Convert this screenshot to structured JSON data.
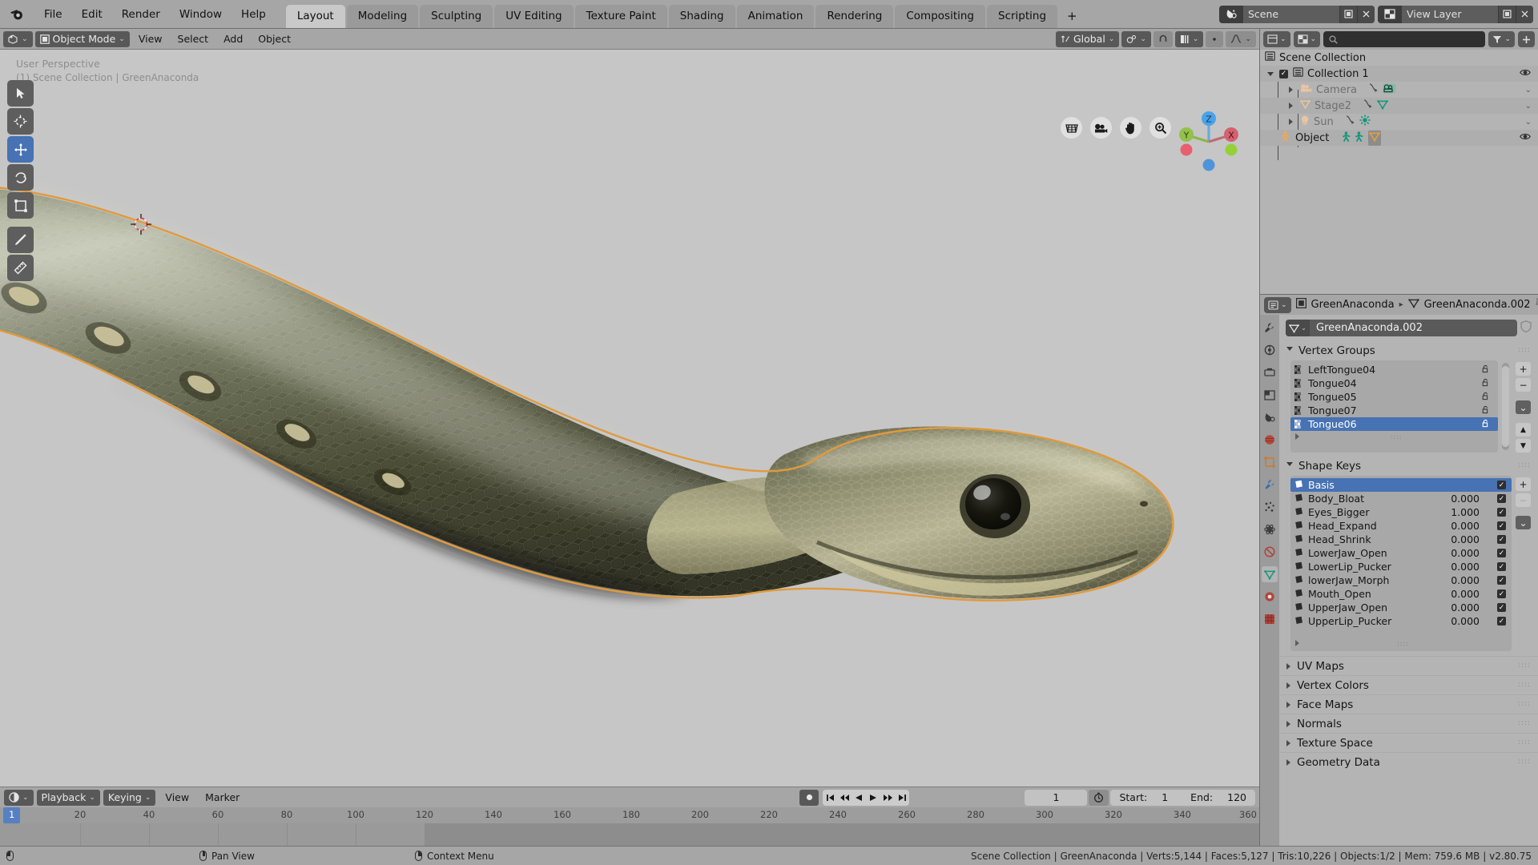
{
  "app": {
    "title": "Blender",
    "version_status": "Scene Collection | GreenAnaconda | Verts:5,144 | Faces:5,127 | Tris:10,226 | Objects:1/2 | Mem: 759.6 MB | v2.80.75"
  },
  "topbar": {
    "menus": [
      "File",
      "Edit",
      "Render",
      "Window",
      "Help"
    ],
    "workspaces": [
      {
        "label": "Layout",
        "active": true
      },
      {
        "label": "Modeling",
        "active": false
      },
      {
        "label": "Sculpting",
        "active": false
      },
      {
        "label": "UV Editing",
        "active": false
      },
      {
        "label": "Texture Paint",
        "active": false
      },
      {
        "label": "Shading",
        "active": false
      },
      {
        "label": "Animation",
        "active": false
      },
      {
        "label": "Rendering",
        "active": false
      },
      {
        "label": "Compositing",
        "active": false
      },
      {
        "label": "Scripting",
        "active": false
      }
    ],
    "add_workspace": "+",
    "scene_name": "Scene",
    "view_layer_name": "View Layer"
  },
  "viewport_header": {
    "mode": "Object Mode",
    "menus": [
      "View",
      "Select",
      "Add",
      "Object"
    ],
    "transform_orientation": "Global",
    "snap_label": "snap-magnet",
    "proportional_label": "proportional-editing"
  },
  "viewport": {
    "perspective_label": "User Perspective",
    "scene_path_label": "(1) Scene Collection | GreenAnaconda",
    "gizmo_axes": {
      "z": "Z",
      "y": "Y",
      "x": "X"
    },
    "tools": [
      "tweak-select-tool",
      "cursor-tool",
      "move-tool",
      "rotate-tool",
      "scale-tool",
      "annotate-tool",
      "measure-tool"
    ],
    "nav_buttons": [
      "grid-view-icon",
      "camera-view-icon",
      "pan-hand-icon",
      "zoom-magnifier-icon"
    ]
  },
  "outliner": {
    "display_mode": "view-layer-icon",
    "filter_icon": "filter-icon",
    "search_placeholder": "",
    "rows": [
      {
        "label": "Scene Collection",
        "indent": 0,
        "icon": "collection-icon",
        "dim": false,
        "checkbox": false,
        "eye": false
      },
      {
        "label": "Collection 1",
        "indent": 1,
        "icon": "collection-icon",
        "dim": false,
        "checkbox": true,
        "eye": true
      },
      {
        "label": "Camera",
        "indent": 2,
        "icon": "camera-icon",
        "dim": true,
        "checkbox": false,
        "eye": false
      },
      {
        "label": "Stage2",
        "indent": 2,
        "icon": "mesh-icon",
        "dim": true,
        "checkbox": false,
        "eye": false
      },
      {
        "label": "Sun",
        "indent": 2,
        "icon": "light-icon",
        "dim": true,
        "checkbox": false,
        "eye": false
      },
      {
        "label": "Object",
        "indent": 1,
        "icon": "armature-icon",
        "dim": false,
        "checkbox": false,
        "eye": true
      }
    ]
  },
  "properties": {
    "breadcrumb": {
      "object_icon": "object-data-icon",
      "object_name": "GreenAnaconda",
      "separator": "▸",
      "data_icon": "mesh-data-icon",
      "data_name": "GreenAnaconda.002"
    },
    "id_field_value": "GreenAnaconda.002",
    "tabs": [
      "tool-icon",
      "render-icon",
      "output-icon",
      "view-layer-icon",
      "scene-icon",
      "world-icon",
      "object-properties-icon",
      "modifier-wrench-icon",
      "particles-icon",
      "physics-icon",
      "constraints-icon",
      "object-data-green-icon",
      "material-icon",
      "texture-icon"
    ],
    "vertex_groups": {
      "title": "Vertex Groups",
      "items": [
        {
          "name": "LeftTongue04",
          "selected": false
        },
        {
          "name": "Tongue04",
          "selected": false
        },
        {
          "name": "Tongue05",
          "selected": false
        },
        {
          "name": "Tongue07",
          "selected": false
        },
        {
          "name": "Tongue06",
          "selected": true
        }
      ],
      "buttons": [
        "+",
        "−",
        "⌄",
        "▲",
        "▼"
      ]
    },
    "shape_keys": {
      "title": "Shape Keys",
      "items": [
        {
          "name": "Basis",
          "value": "",
          "enabled": true,
          "selected": true
        },
        {
          "name": "Body_Bloat",
          "value": "0.000",
          "enabled": true,
          "selected": false
        },
        {
          "name": "Eyes_Bigger",
          "value": "1.000",
          "enabled": true,
          "selected": false
        },
        {
          "name": "Head_Expand",
          "value": "0.000",
          "enabled": true,
          "selected": false
        },
        {
          "name": "Head_Shrink",
          "value": "0.000",
          "enabled": true,
          "selected": false
        },
        {
          "name": "LowerJaw_Open",
          "value": "0.000",
          "enabled": true,
          "selected": false
        },
        {
          "name": "LowerLip_Pucker",
          "value": "0.000",
          "enabled": true,
          "selected": false
        },
        {
          "name": "lowerJaw_Morph",
          "value": "0.000",
          "enabled": true,
          "selected": false
        },
        {
          "name": "Mouth_Open",
          "value": "0.000",
          "enabled": true,
          "selected": false
        },
        {
          "name": "UpperJaw_Open",
          "value": "0.000",
          "enabled": true,
          "selected": false
        },
        {
          "name": "UpperLip_Pucker",
          "value": "0.000",
          "enabled": true,
          "selected": false
        }
      ],
      "buttons": [
        "+",
        "−",
        "⌄"
      ]
    },
    "collapsed_panels": [
      "UV Maps",
      "Vertex Colors",
      "Face Maps",
      "Normals",
      "Texture Space",
      "Geometry Data"
    ]
  },
  "timeline": {
    "editor_icon": "timeline-icon",
    "menus": [
      "Playback",
      "Keying",
      "View",
      "Marker"
    ],
    "current_frame": "1",
    "start_label": "Start:",
    "start_value": "1",
    "end_label": "End:",
    "end_value": "120",
    "playhead_frame": "1",
    "ticks": [
      "20",
      "40",
      "60",
      "80",
      "100",
      "120",
      "140",
      "160",
      "180",
      "200",
      "220",
      "240",
      "260",
      "280",
      "300",
      "320",
      "340",
      "360"
    ]
  },
  "statusbar": {
    "left_hint": "",
    "pan_view": "Pan View",
    "context_menu": "Context Menu",
    "info": "Scene Collection | GreenAnaconda | Verts:5,144 | Faces:5,127 | Tris:10,226 | Objects:1/2 | Mem: 759.6 MB | v2.80.75"
  },
  "colors": {
    "accent_blue": "#4772b3",
    "panel_bg": "#b4b4b4",
    "header_bg": "#a6a6a6",
    "viewport_bg": "#c6c6c6",
    "outline_orange": "#e09a3c"
  }
}
